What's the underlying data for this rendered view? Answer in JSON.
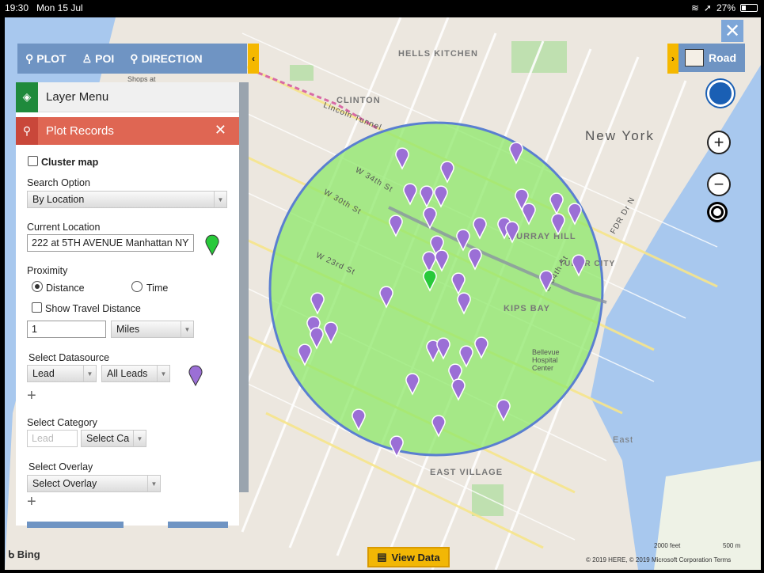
{
  "status": {
    "time": "19:30",
    "date": "Mon 15 Jul",
    "battery": "27%"
  },
  "toolbar": {
    "plot": "PLOT",
    "poi": "POI",
    "direction": "DIRECTION"
  },
  "map_style": {
    "label": "Road"
  },
  "layer_menu": {
    "label": "Layer Menu"
  },
  "plot_records": {
    "title": "Plot Records",
    "cluster_map": "Cluster map",
    "search_option_label": "Search Option",
    "search_option_value": "By Location",
    "current_location_label": "Current Location",
    "current_location_value": "222 at 5TH AVENUE Manhattan NY",
    "proximity_label": "Proximity",
    "distance": "Distance",
    "time": "Time",
    "show_travel_distance": "Show Travel Distance",
    "distance_value": "1",
    "unit_value": "Miles",
    "select_datasource_label": "Select Datasource",
    "datasource_value": "Lead",
    "datasource_filter": "All Leads",
    "select_category_label": "Select Category",
    "category_placeholder": "Lead",
    "category_select": "Select Ca",
    "select_overlay_label": "Select Overlay",
    "overlay_value": "Select Overlay"
  },
  "map_labels": {
    "hells_kitchen": "HELLS KITCHEN",
    "clinton": "CLINTON",
    "new_york": "New York",
    "murray_hill": "MURRAY HILL",
    "kips_bay": "KIPS BAY",
    "east_village": "EAST VILLAGE",
    "tudor_city": "TUDOR CITY",
    "east": "East",
    "w34": "W 34th St",
    "w30": "W 30th St",
    "w23": "W 23rd St",
    "e34": "E 34th St",
    "fdr": "FDR Dr N",
    "lincoln_tunnel": "Lincoln Tunnel",
    "shops_at": "Shops at",
    "bellevue": "Bellevue Hospital Center"
  },
  "colors": {
    "marker": "#9b6fd6",
    "origin_marker": "#28c93a",
    "radius_fill": "#8ee86a",
    "radius_stroke": "#5a7fd0"
  },
  "footer": {
    "view_data": "View Data",
    "bing": "Bing",
    "copyright": "© 2019 HERE, © 2019 Microsoft Corporation  Terms",
    "scale_feet": "2000 feet",
    "scale_m": "500 m"
  }
}
